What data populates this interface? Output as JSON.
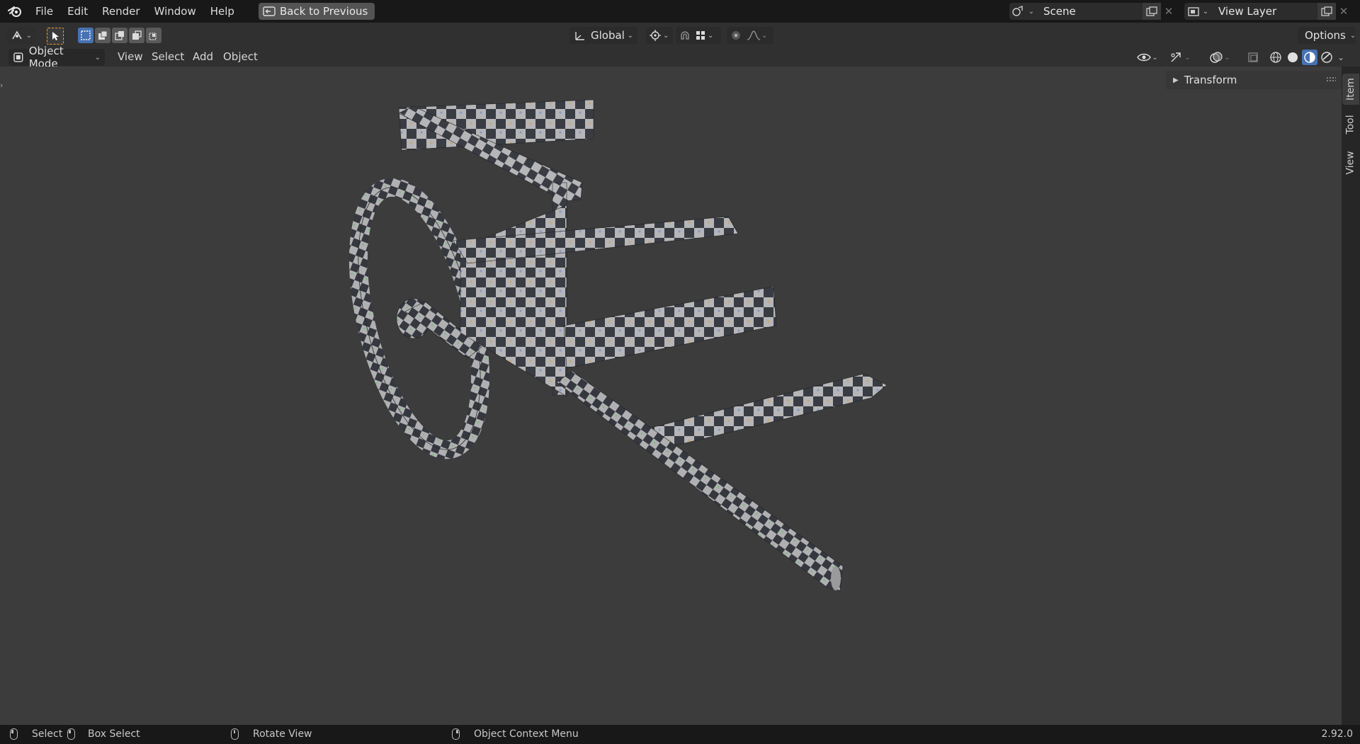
{
  "menubar": {
    "items": [
      "File",
      "Edit",
      "Render",
      "Window",
      "Help"
    ],
    "back_button": "Back to Previous"
  },
  "scene": {
    "name": "Scene"
  },
  "view_layer": {
    "name": "View Layer"
  },
  "toolheader": {
    "transform_orientation": "Global",
    "options_label": "Options"
  },
  "viewheader": {
    "mode": "Object Mode",
    "menus": [
      "View",
      "Select",
      "Add",
      "Object"
    ]
  },
  "npanel": {
    "tabs": [
      "Item",
      "Tool",
      "View"
    ],
    "active_tab": "Item",
    "transform_label": "Transform"
  },
  "statusbar": {
    "select": "Select",
    "box_select": "Box Select",
    "rotate_view": "Rotate View",
    "context_menu": "Object Context Menu",
    "version": "2.92.0"
  },
  "colors": {
    "accent": "#4772b3",
    "active_tool_outline": "#f0a030",
    "viewport_bg": "#3c3c3c"
  }
}
